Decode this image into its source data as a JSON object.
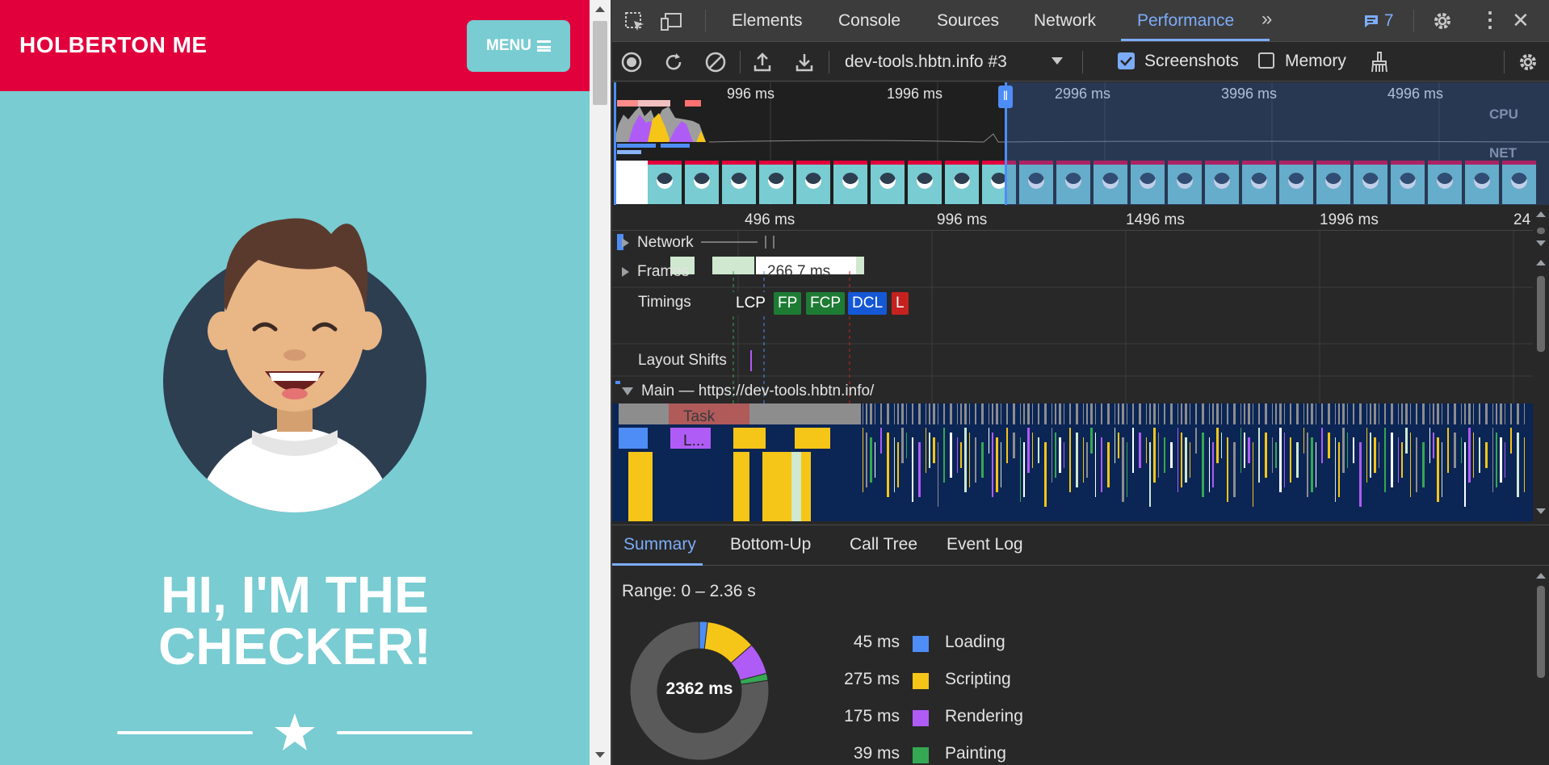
{
  "site": {
    "brand": "HOLBERTON ME",
    "menu_label": "MENU",
    "headline_line1": "HI, I'M THE",
    "headline_line2": "CHECKER!",
    "colors": {
      "nav": "#e1003c",
      "background": "#78ccd2",
      "avatar_circle": "#2d3e50"
    }
  },
  "devtools": {
    "tabs": [
      "Elements",
      "Console",
      "Sources",
      "Network",
      "Performance"
    ],
    "active_tab": "Performance",
    "issues_count": "7",
    "recording_select": "dev-tools.hbtn.info #3",
    "screenshots_label": "Screenshots",
    "screenshots_checked": true,
    "memory_label": "Memory",
    "memory_checked": false,
    "overview_ticks": [
      "996 ms",
      "1996 ms",
      "2996 ms",
      "3996 ms",
      "4996 ms"
    ],
    "cpu_label": "CPU",
    "net_label": "NET",
    "ruler_ticks": [
      "496 ms",
      "996 ms",
      "1496 ms",
      "1996 ms",
      "24"
    ],
    "tracks": {
      "network": "Network",
      "frames": "Frames",
      "frame_duration": "266.7 ms",
      "timings": "Timings",
      "layout_shifts": "Layout Shifts",
      "main": "Main — https://dev-tools.hbtn.info/",
      "task": "Task",
      "task_child": "L..."
    },
    "timing_badges": [
      {
        "label": "LCP",
        "color": "#282828"
      },
      {
        "label": "FP",
        "color": "#1e7b34"
      },
      {
        "label": "FCP",
        "color": "#1e7b34"
      },
      {
        "label": "DCL",
        "color": "#1558d6"
      },
      {
        "label": "L",
        "color": "#c5221f"
      }
    ],
    "bottom_tabs": [
      "Summary",
      "Bottom-Up",
      "Call Tree",
      "Event Log"
    ],
    "active_bottom_tab": "Summary",
    "summary": {
      "range": "Range: 0 – 2.36 s",
      "total": "2362 ms",
      "rows": [
        {
          "ms": "45 ms",
          "name": "Loading",
          "color": "#4e8df5"
        },
        {
          "ms": "275 ms",
          "name": "Scripting",
          "color": "#f5c518"
        },
        {
          "ms": "175 ms",
          "name": "Rendering",
          "color": "#af5cf7"
        },
        {
          "ms": "39 ms",
          "name": "Painting",
          "color": "#34a853"
        }
      ]
    }
  }
}
